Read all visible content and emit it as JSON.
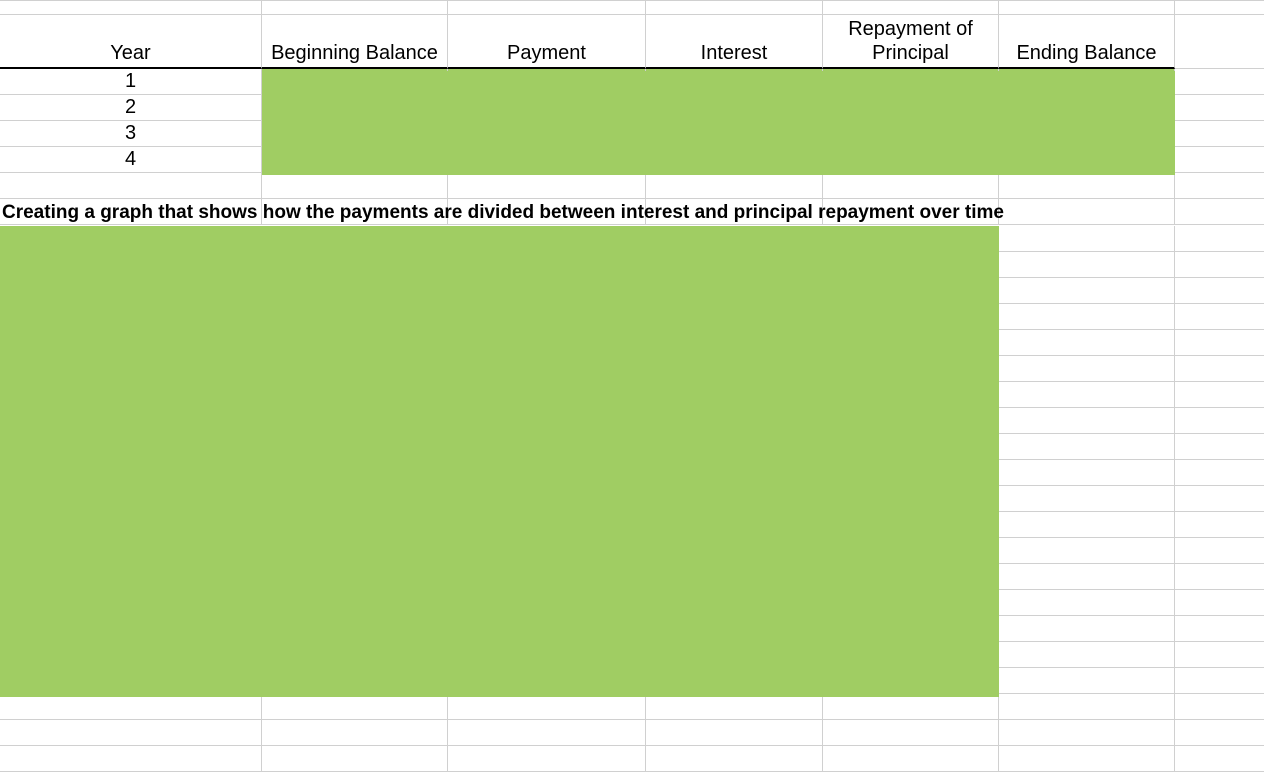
{
  "table": {
    "headers": {
      "year": "Year",
      "beginning_balance": "Beginning Balance",
      "payment": "Payment",
      "interest": "Interest",
      "repayment_principal": "Repayment of Principal",
      "ending_balance": "Ending Balance"
    },
    "years": [
      "1",
      "2",
      "3",
      "4"
    ]
  },
  "description": "Creating a graph that shows how the payments are divided between interest and principal repayment over time",
  "highlight_color": "#a0cd63"
}
